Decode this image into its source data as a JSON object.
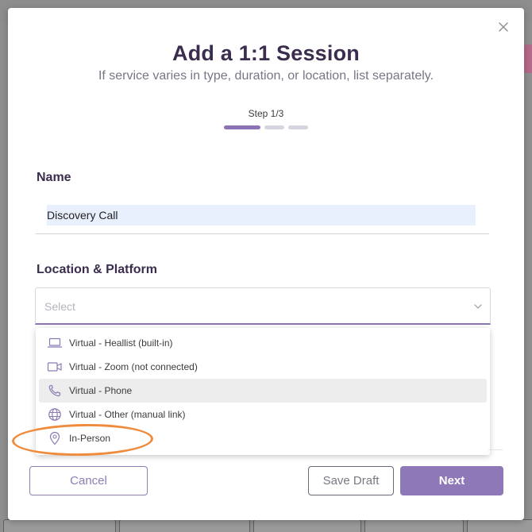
{
  "colors": {
    "accent": "#8e78b8",
    "step_active": "#8a73b5",
    "step_inactive": "#d7d4df",
    "annotation": "#ee8b3c",
    "input_autofill": "#e8f0fe"
  },
  "modal": {
    "title": "Add a 1:1 Session",
    "subtitle": "If service varies in type, duration, or location, list separately.",
    "close_icon": "close-icon",
    "step": {
      "label": "Step 1/3",
      "current": 1,
      "total": 3
    },
    "name_field": {
      "label": "Name",
      "value": "Discovery Call"
    },
    "location_field": {
      "label": "Location & Platform",
      "placeholder": "Select",
      "options": [
        {
          "icon": "laptop-icon",
          "label": "Virtual - Heallist (built-in)"
        },
        {
          "icon": "video-camera-icon",
          "label": "Virtual - Zoom (not connected)"
        },
        {
          "icon": "phone-icon",
          "label": "Virtual - Phone",
          "highlighted": true
        },
        {
          "icon": "globe-icon",
          "label": "Virtual - Other (manual link)"
        },
        {
          "icon": "map-pin-icon",
          "label": "In-Person",
          "annotated": true
        }
      ]
    },
    "buttons": {
      "cancel": "Cancel",
      "save_draft": "Save Draft",
      "next": "Next"
    }
  }
}
